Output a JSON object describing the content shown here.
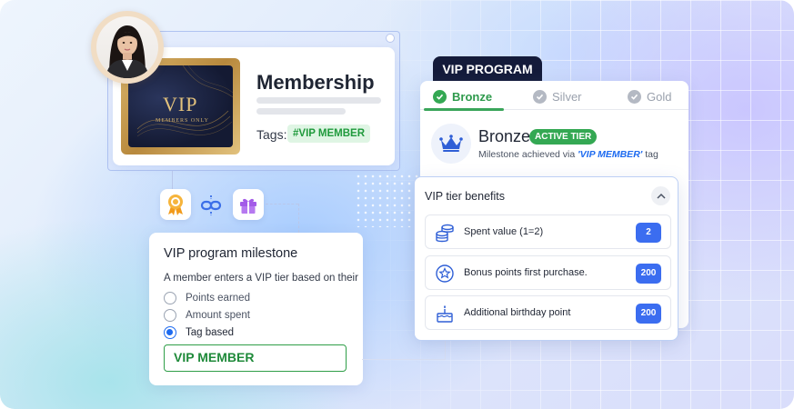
{
  "membership": {
    "title": "Membership",
    "tags_label": "Tags:",
    "tag": "#VIP MEMBER",
    "card": {
      "word": "VIP",
      "subtitle": "MEMBERS ONLY"
    }
  },
  "milestone": {
    "title": "VIP program milestone",
    "description": "A member enters a VIP tier based on their",
    "options": [
      {
        "label": "Points earned",
        "checked": false
      },
      {
        "label": "Amount spent",
        "checked": false
      },
      {
        "label": "Tag based",
        "checked": true
      }
    ],
    "tag_value": "VIP MEMBER"
  },
  "vip_program": {
    "tab_label": "VIP PROGRAM",
    "tiers": [
      {
        "label": "Bronze",
        "active": true
      },
      {
        "label": "Silver",
        "active": false
      },
      {
        "label": "Gold",
        "active": false
      }
    ],
    "current_tier": "Bronze",
    "active_badge": "ACTIVE TIER",
    "note_prefix": "Milestone achieved via ",
    "note_tag": "'VIP MEMBER'",
    "note_suffix": " tag"
  },
  "benefits": {
    "title": "VIP tier benefits",
    "items": [
      {
        "label": "Spent value (1=2)",
        "value": "2",
        "icon": "coins-icon"
      },
      {
        "label": "Bonus points first purchase.",
        "value": "200",
        "icon": "star-badge-icon"
      },
      {
        "label": "Additional birthday point",
        "value": "200",
        "icon": "cake-icon"
      }
    ]
  },
  "colors": {
    "accent_blue": "#1e6bf0",
    "tier_green": "#34a853",
    "vip_dark": "#141b3a",
    "gold": "#d9b46a"
  }
}
